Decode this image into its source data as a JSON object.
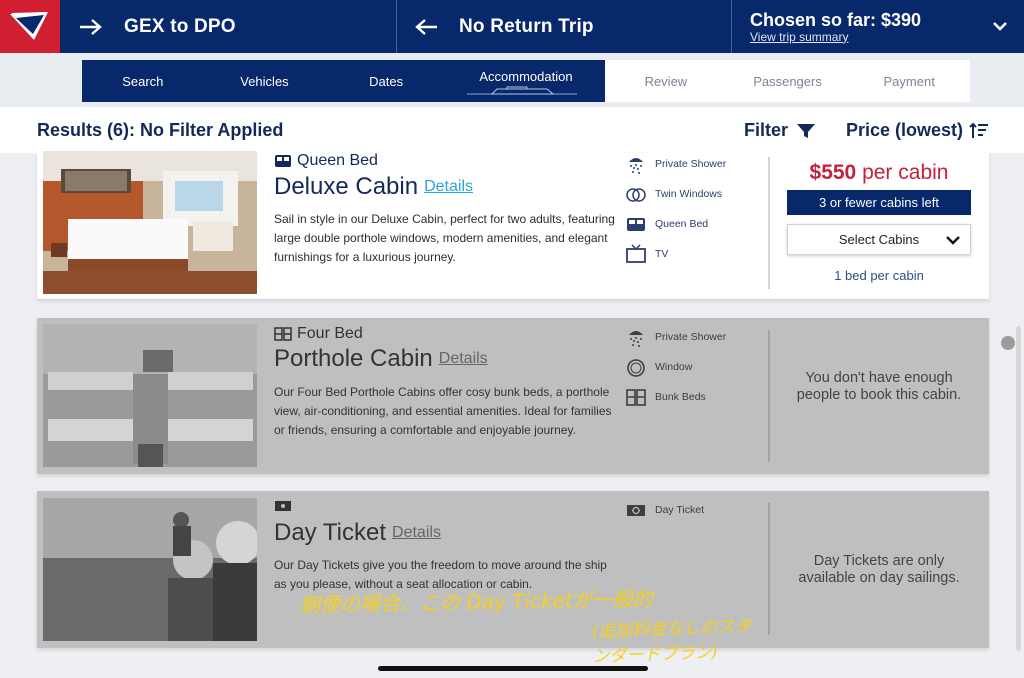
{
  "header": {
    "route": "GEX to DPO",
    "return": "No Return Trip",
    "chosen": "Chosen so far: $390",
    "summary_link": "View trip summary"
  },
  "steps": [
    {
      "label": "Search",
      "state": "done"
    },
    {
      "label": "Vehicles",
      "state": "done"
    },
    {
      "label": "Dates",
      "state": "done"
    },
    {
      "label": "Accommodation",
      "state": "current"
    },
    {
      "label": "Review",
      "state": "todo"
    },
    {
      "label": "Passengers",
      "state": "todo"
    },
    {
      "label": "Payment",
      "state": "todo"
    }
  ],
  "results": {
    "title": "Results (6): No Filter Applied",
    "filter": "Filter",
    "sort": "Price (lowest)"
  },
  "cards": [
    {
      "bed": "Queen Bed",
      "name": "Deluxe Cabin",
      "details": "Details",
      "desc": "Sail in style in our Deluxe Cabin, perfect for two adults, featuring large double porthole windows, modern amenities, and elegant furnishings for a luxurious journey.",
      "amenities": [
        {
          "label": "Private Shower",
          "icon": "shower-icon"
        },
        {
          "label": "Twin Windows",
          "icon": "twin-windows-icon"
        },
        {
          "label": "Queen Bed",
          "icon": "bed-icon"
        },
        {
          "label": "TV",
          "icon": "tv-icon"
        }
      ],
      "price": "$550",
      "price_unit": "per cabin",
      "availability": "3 or fewer cabins left",
      "select": "Select Cabins",
      "beds": "1 bed per cabin"
    },
    {
      "bed": "Four Bed",
      "name": "Porthole Cabin",
      "details": "Details",
      "desc": "Our Four Bed Porthole Cabins offer cosy bunk beds, a porthole view, air-conditioning, and essential amenities. Ideal for families or friends, ensuring a comfortable and enjoyable journey.",
      "amenities": [
        {
          "label": "Private Shower",
          "icon": "shower-icon"
        },
        {
          "label": "Window",
          "icon": "window-icon"
        },
        {
          "label": "Bunk Beds",
          "icon": "bunk-beds-icon"
        }
      ],
      "notice": "You don't have enough people to book this cabin."
    },
    {
      "bed": "",
      "name": "Day Ticket",
      "details": "Details",
      "desc": "Our Day Tickets give you the freedom to move around the ship as you please, without a seat allocation or cabin.",
      "amenities": [
        {
          "label": "Day Ticket",
          "icon": "day-ticket-icon"
        }
      ],
      "notice": "Day Tickets are only available on day sailings."
    }
  ],
  "annotation": {
    "line1": "朝便の場合、この Day Ticketが一般的",
    "line2": "(追加料金なしのスタンダードプラン)"
  },
  "colors": {
    "navy": "#07286a",
    "red": "#c4213a",
    "link": "#2aa4d9"
  }
}
